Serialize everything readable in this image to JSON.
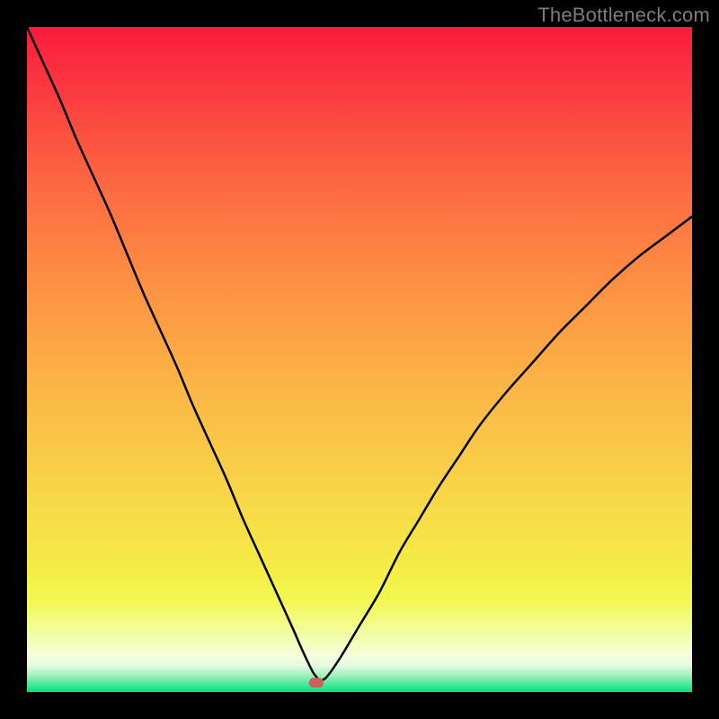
{
  "watermark": {
    "text": "TheBottleneck.com"
  },
  "chart_data": {
    "type": "line",
    "title": "",
    "xlabel": "",
    "ylabel": "",
    "xlim": [
      0,
      100
    ],
    "ylim": [
      0,
      100
    ],
    "annotations": [],
    "background_gradient": {
      "0": "#f81b3e",
      "100": "#00e07d"
    },
    "series": [
      {
        "name": "bottleneck-curve",
        "x": [
          0,
          2.5,
          5,
          7.5,
          10,
          12.5,
          15,
          17.5,
          20,
          22.5,
          25,
          27.5,
          30,
          32.5,
          35,
          37.5,
          40,
          41,
          42,
          43,
          43.5,
          44,
          45,
          47,
          50,
          53,
          56,
          59,
          62,
          65,
          68,
          72,
          76,
          80,
          84,
          88,
          92,
          96,
          100
        ],
        "values": [
          100,
          94.5,
          89,
          83,
          77.5,
          72,
          66,
          60,
          54.5,
          49,
          43,
          37.5,
          32,
          26,
          20.5,
          15,
          9.5,
          7.2,
          5,
          3,
          2.3,
          1.8,
          2.2,
          5,
          10,
          15,
          21,
          26,
          31,
          35.5,
          40,
          45,
          49.5,
          54,
          58,
          62,
          65.5,
          68.5,
          71.5
        ]
      }
    ],
    "marker": {
      "name": "optimal-point",
      "x": 43.5,
      "y": 1.4,
      "color": "#cc605a",
      "shape": "rounded-rect"
    }
  }
}
